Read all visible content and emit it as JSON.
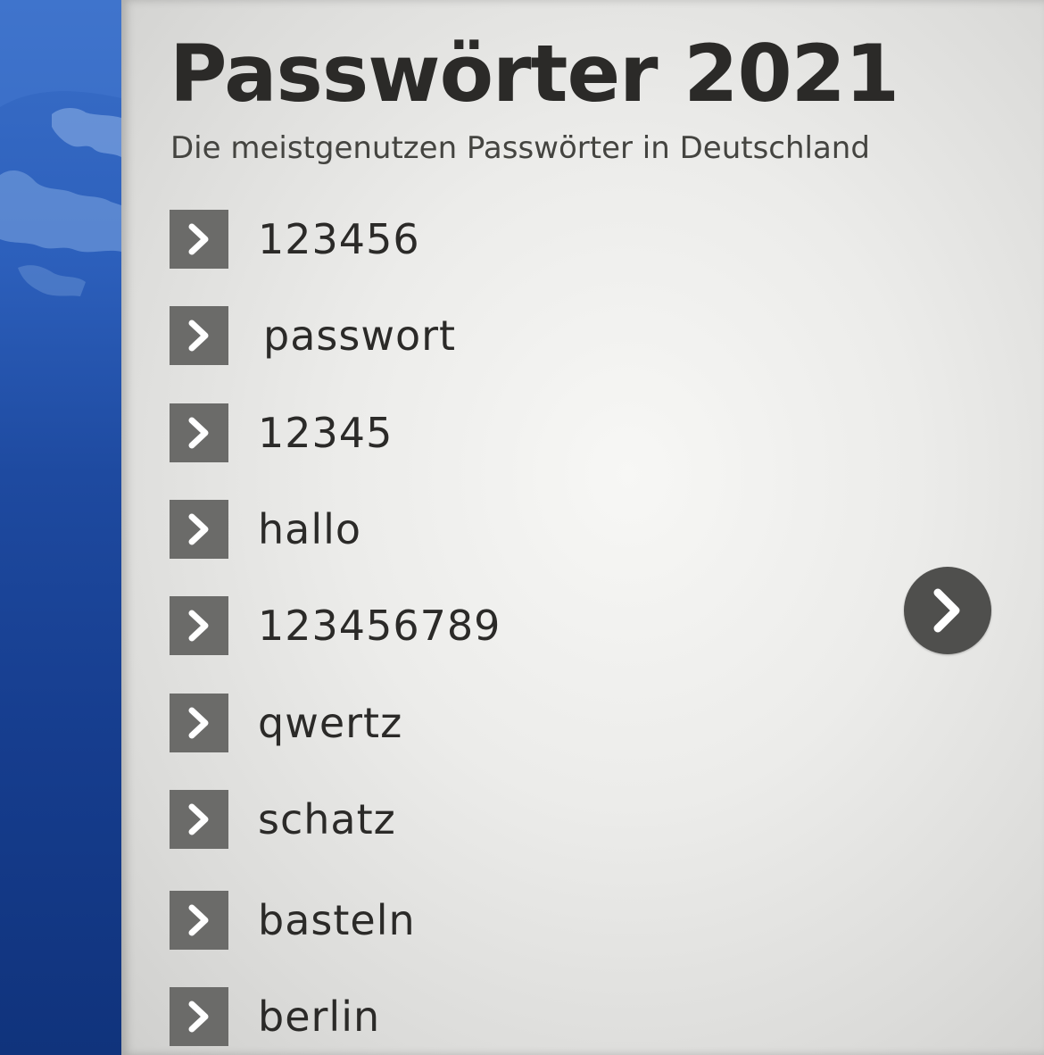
{
  "header": {
    "title": "Passwörter 2021",
    "subtitle": "Die meistgenutzen Passwörter in Deutschland"
  },
  "passwords": [
    {
      "label": "123456",
      "icon": "chevron-right-icon"
    },
    {
      "label": "passwort",
      "icon": "chevron-right-icon"
    },
    {
      "label": "12345",
      "icon": "chevron-right-icon"
    },
    {
      "label": "hallo",
      "icon": "chevron-right-icon"
    },
    {
      "label": "123456789",
      "icon": "chevron-right-icon"
    },
    {
      "label": "qwertz",
      "icon": "chevron-right-icon"
    },
    {
      "label": "schatz",
      "icon": "chevron-right-icon"
    },
    {
      "label": "basteln",
      "icon": "chevron-right-icon"
    },
    {
      "label": "berlin",
      "icon": "chevron-right-icon"
    }
  ],
  "next_button": {
    "icon": "chevron-right-icon"
  },
  "colors": {
    "background_band": "#1e4aa0",
    "panel": "#ececea",
    "text": "#2b2a28",
    "arrow_box": "#6b6b69",
    "next_button": "#4f4f4d"
  }
}
